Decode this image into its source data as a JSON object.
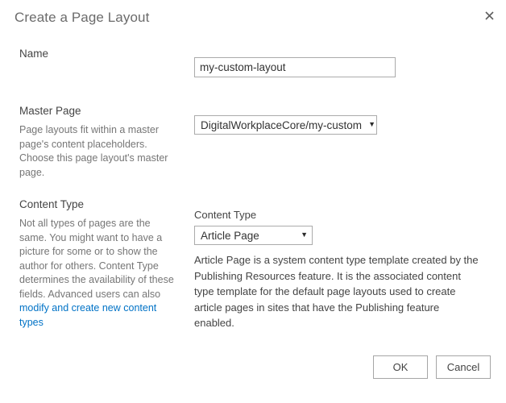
{
  "dialog": {
    "title": "Create a Page Layout",
    "close_icon": "close-icon",
    "close_glyph": "✕"
  },
  "fields": {
    "name": {
      "title": "Name",
      "value": "my-custom-layout",
      "placeholder": ""
    },
    "master_page": {
      "title": "Master Page",
      "description": "Page layouts fit within a master page's content placeholders. Choose this page layout's master page.",
      "selected": "DigitalWorkplaceCore/my-custom",
      "caret": "▼"
    },
    "content_type": {
      "title": "Content Type",
      "description_part1": "Not all types of pages are the same. You might want to have a picture for some or to show the author for others. Content Type determines the availability of these fields. Advanced users can also ",
      "link_text": "modify and create new content types",
      "sub_label": "Content Type",
      "selected": "Article Page",
      "caret": "▼",
      "selected_description": "Article Page is a system content type template created by the Publishing Resources feature. It is the associated content type template for the default page layouts used to create article pages in sites that have the Publishing feature enabled."
    }
  },
  "footer": {
    "ok_label": "OK",
    "cancel_label": "Cancel"
  },
  "colors": {
    "link": "#0072c6",
    "title_text": "#6b6b6b",
    "body_text": "#444444",
    "muted_text": "#767676",
    "border": "#ababab",
    "background": "#ffffff"
  }
}
